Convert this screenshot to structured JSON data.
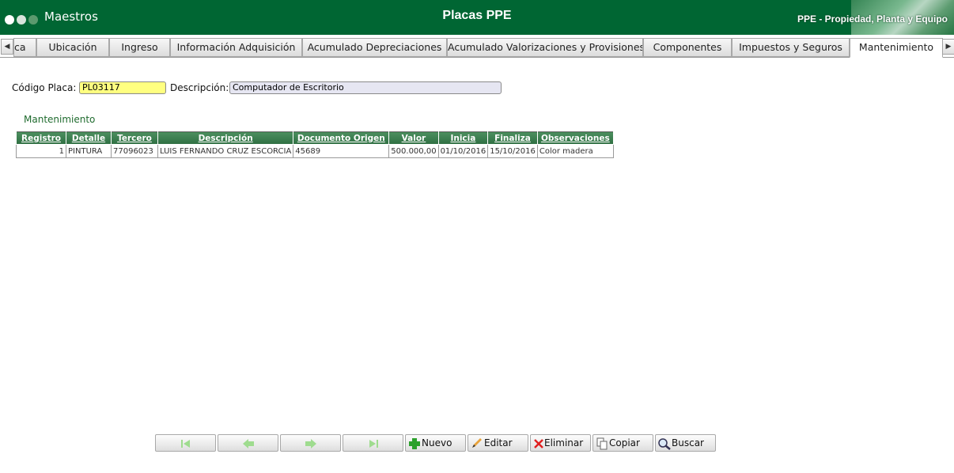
{
  "window": {
    "app_title": "Maestros",
    "title": "Placas PPE",
    "module": "PPE - Propiedad, Planta y Equipo"
  },
  "colors": {
    "header_bg": "#006633",
    "dot_white": "#ffffff",
    "dot_light": "#d8e4dc",
    "dot_mid": "#5b9a6e",
    "placa_bg": "#ffff80",
    "desc_bg": "#e6e6f2",
    "grid_header": "#3d7f50"
  },
  "tabs": [
    {
      "label": "ca"
    },
    {
      "label": "Ubicación"
    },
    {
      "label": "Ingreso"
    },
    {
      "label": "Información Adquisición"
    },
    {
      "label": "Acumulado Depreciaciones"
    },
    {
      "label": "Acumulado Valorizaciones y Provisiones"
    },
    {
      "label": "Componentes"
    },
    {
      "label": "Impuestos y Seguros"
    },
    {
      "label": "Mantenimiento"
    }
  ],
  "active_tab": "Mantenimiento",
  "form": {
    "codigo_label": "Código Placa:",
    "codigo_value": "PL03117",
    "descripcion_label": "Descripción:",
    "descripcion_value": "Computador de Escritorio"
  },
  "section": {
    "title": "Mantenimiento"
  },
  "grid": {
    "columns": [
      "Registro",
      "Detalle",
      "Tercero",
      "Descripción",
      "Documento Origen",
      "Valor",
      "Inicia",
      "Finaliza",
      "Observaciones"
    ],
    "rows": [
      [
        "1",
        "PINTURA",
        "77096023",
        "LUIS FERNANDO CRUZ ESCORCIA",
        "45689",
        "500.000,00",
        "01/10/2016",
        "15/10/2016",
        "Color madera"
      ]
    ]
  },
  "toolbar": {
    "nuevo": "Nuevo",
    "editar": "Editar",
    "eliminar": "Eliminar",
    "copiar": "Copiar",
    "buscar": "Buscar"
  }
}
